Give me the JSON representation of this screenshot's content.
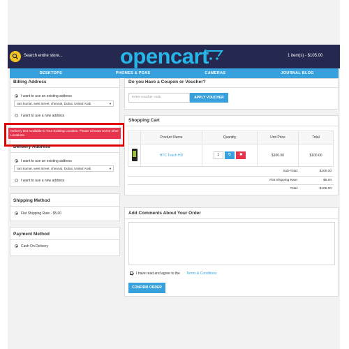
{
  "header": {
    "search_placeholder": "Search entire store...",
    "logo": "opencart",
    "cart_status": "1 item(s) - $105.00"
  },
  "nav": [
    "DESKTOPS",
    "PHONES & PDAS",
    "CAMERAS",
    "JOURNAL BLOG"
  ],
  "billing": {
    "title": "Billing Address",
    "existing_label": "I want to use an existing address",
    "address_value": "ram kumar, west street, chennai, Dubai, United Arab",
    "new_label": "I want to use a new address"
  },
  "error": {
    "message": "Delivery Not Available to Your Existing Location. Please Choose Some other Locations."
  },
  "delivery": {
    "title": "Delivery Address",
    "existing_label": "I want to use an existing address",
    "address_value": "ram kumar, west street, chennai, Dubai, United Arab",
    "new_label": "I want to use a new address"
  },
  "shipping": {
    "title": "Shipping Method",
    "option": "Flat Shipping Rate - $5.00"
  },
  "payment": {
    "title": "Payment Method",
    "option": "Cash On Delivery"
  },
  "coupon": {
    "title": "Do you Have a Coupon or Voucher?",
    "placeholder": "Enter voucher code",
    "button": "APPLY VOUCHER"
  },
  "cart": {
    "title": "Shopping Cart",
    "columns": [
      "Product Name",
      "Quantity",
      "Unit Price",
      "Total"
    ],
    "rows": [
      {
        "name": "HTC Touch HD",
        "quantity": "1",
        "unit_price": "$100.00",
        "total": "$100.00"
      }
    ],
    "totals": [
      {
        "label": "Sub-Total:",
        "value": "$100.00"
      },
      {
        "label": "Flat Shipping Rate:",
        "value": "$5.00"
      },
      {
        "label": "Total:",
        "value": "$105.00"
      }
    ]
  },
  "comments": {
    "title": "Add Comments About Your Order"
  },
  "terms": {
    "prefix": "I have read and agree to the",
    "link": "Terms & Conditions"
  },
  "confirm": {
    "button": "CONFIRM ORDER"
  },
  "colors": {
    "topbar": "#26294f",
    "nav": "#37a1dd",
    "error": "#e6344d",
    "highlight": "#e10000",
    "accent": "#37a1dd"
  }
}
